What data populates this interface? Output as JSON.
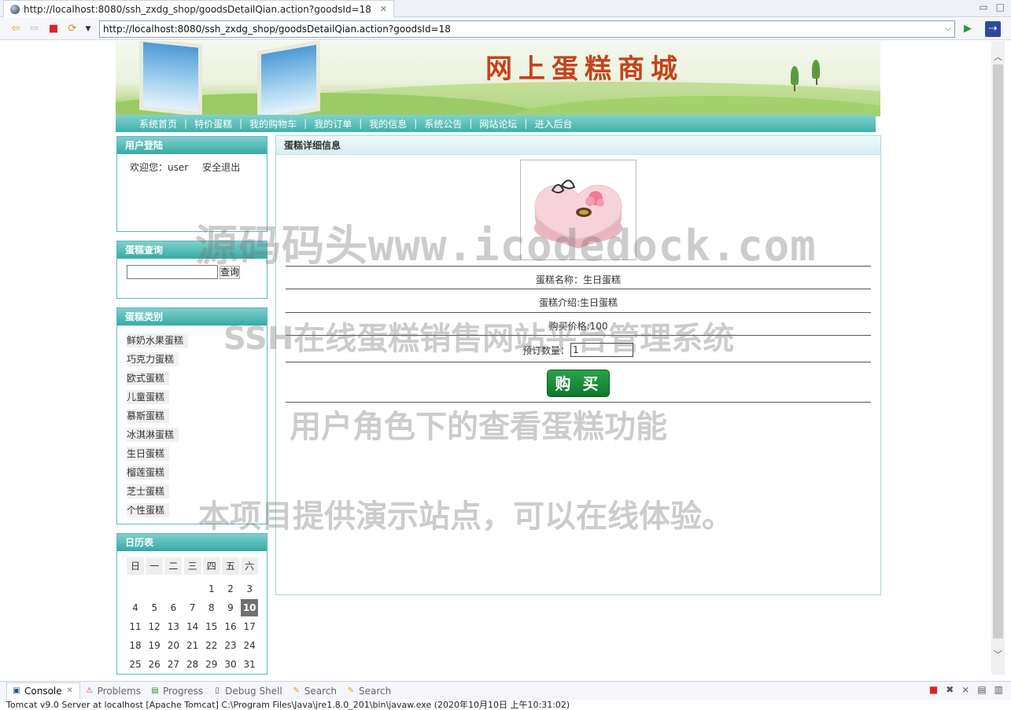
{
  "browser": {
    "tab_title": "http://localhost:8080/ssh_zxdg_shop/goodsDetailQian.action?goodsId=18",
    "url": "http://localhost:8080/ssh_zxdg_shop/goodsDetailQian.action?goodsId=18"
  },
  "site": {
    "title": "网上蛋糕商城",
    "nav": [
      "系统首页",
      "特价蛋糕",
      "我的购物车",
      "我的订单",
      "我的信息",
      "系统公告",
      "网站论坛",
      "进入后台"
    ],
    "nav_separator": "|"
  },
  "sidebar": {
    "login": {
      "title": "用户登陆",
      "welcome": "欢迎您：user",
      "logout": "安全退出"
    },
    "search": {
      "title": "蛋糕查询",
      "input_value": "",
      "button": "查询"
    },
    "categories": {
      "title": "蛋糕类别",
      "items": [
        "鲜奶水果蛋糕",
        "巧克力蛋糕",
        "欧式蛋糕",
        "儿童蛋糕",
        "慕斯蛋糕",
        "冰淇淋蛋糕",
        "生日蛋糕",
        "榴莲蛋糕",
        "芝士蛋糕",
        "个性蛋糕"
      ]
    },
    "calendar": {
      "title": "日历表",
      "weekdays": [
        "日",
        "一",
        "二",
        "三",
        "四",
        "五",
        "六"
      ],
      "weeks": [
        [
          "",
          "",
          "",
          "",
          "1",
          "2",
          "3"
        ],
        [
          "4",
          "5",
          "6",
          "7",
          "8",
          "9",
          "10"
        ],
        [
          "11",
          "12",
          "13",
          "14",
          "15",
          "16",
          "17"
        ],
        [
          "18",
          "19",
          "20",
          "21",
          "22",
          "23",
          "24"
        ],
        [
          "25",
          "26",
          "27",
          "28",
          "29",
          "30",
          "31"
        ]
      ],
      "today": "10"
    }
  },
  "main": {
    "title": "蛋糕详细信息",
    "name_line": "蛋糕名称：生日蛋糕",
    "intro_line": "蛋糕介绍:生日蛋糕",
    "price_line": "购买价格:100",
    "qty_label": "预订数量：",
    "qty_value": "1",
    "buy_button": "购 买"
  },
  "watermarks": [
    "源码码头www.icodedock.com",
    "SSH在线蛋糕销售网站平台管理系统",
    "用户角色下的查看蛋糕功能",
    "本项目提供演示站点，可以在线体验。"
  ],
  "console": {
    "tabs": [
      "Console",
      "Problems",
      "Progress",
      "Debug Shell",
      "Search",
      "Search"
    ],
    "status_line": "Tomcat v9.0 Server at localhost [Apache Tomcat] C:\\Program Files\\Java\\jre1.8.0_201\\bin\\javaw.exe (2020年10月10日 上午10:31:02)"
  },
  "colors": {
    "nav_teal": "#3fb0ab",
    "title_red": "#c4431a",
    "buy_green": "#0c7a2a"
  }
}
